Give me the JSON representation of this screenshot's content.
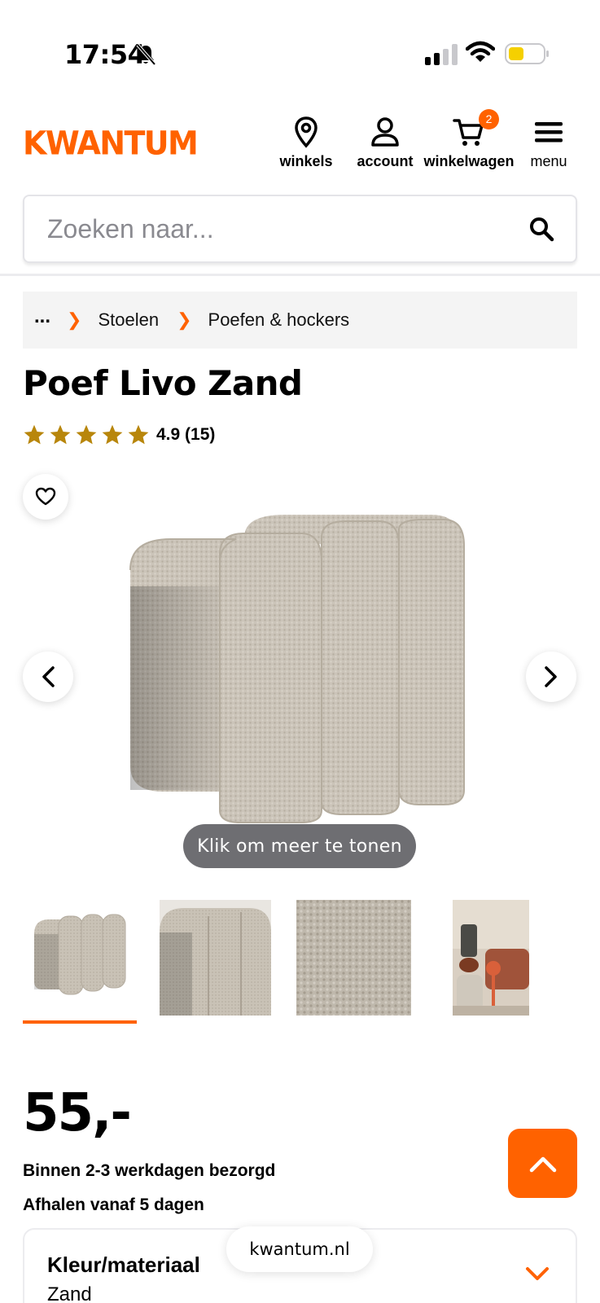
{
  "status_bar": {
    "time": "17:54",
    "battery_color": "#f5d000"
  },
  "header": {
    "logo": "KWANTUM",
    "brand_color": "#ff6200",
    "nav": {
      "stores": "winkels",
      "account": "account",
      "cart": "winkelwagen",
      "cart_count": "2",
      "menu": "menu"
    }
  },
  "search": {
    "placeholder": "Zoeken naar..."
  },
  "breadcrumb": {
    "ellipsis": "...",
    "items": [
      "Stoelen",
      "Poefen & hockers"
    ]
  },
  "product": {
    "title": "Poef Livo Zand",
    "rating_stars": 5,
    "rating_text": "4.9 (15)",
    "star_color": "#b8860b",
    "more_label": "Klik om meer te tonen",
    "thumbnails": 4,
    "active_thumbnail": 1
  },
  "price": {
    "value": "55,-",
    "delivery": "Binnen 2-3 werkdagen bezorgd",
    "pickup": "Afhalen vanaf 5 dagen"
  },
  "options": {
    "label": "Kleur/materiaal",
    "value": "Zand"
  },
  "browser": {
    "url": "kwantum.nl"
  }
}
